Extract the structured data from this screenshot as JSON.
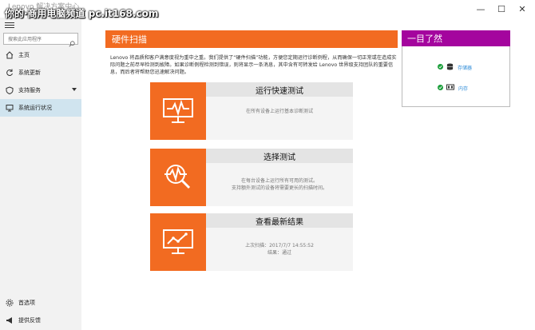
{
  "window": {
    "title": "Lenovo 解决方案中心",
    "watermark": "你的·商用电脑频道 pc.it168.com",
    "minimize": "—",
    "maximize": "☐",
    "close": "✕"
  },
  "sidebar": {
    "search_placeholder": "搜索此应用程序",
    "items": [
      {
        "label": "主页",
        "icon": "home-icon"
      },
      {
        "label": "系统更新",
        "icon": "refresh-icon"
      },
      {
        "label": "支持服务",
        "icon": "shield-icon"
      },
      {
        "label": "系统运行状况",
        "icon": "monitor-icon"
      }
    ],
    "bottom": [
      {
        "label": "首选项",
        "icon": "gear-icon"
      },
      {
        "label": "提供反馈",
        "icon": "megaphone-icon"
      }
    ]
  },
  "main": {
    "header": "硬件扫描",
    "description": "Lenovo 将品质和客户满意度视为重中之重。我们提供了“硬件扫描”功能，方便您定期运行诊断例程，从而确保一切正常或在造成实际问题之前尽早检测到故障。如果诊断例程检测到错误，则将显示一条消息，其中含有可转发给 Lenovo 世界级支持团队的重要信息，而后者将帮助您迅速解决问题。",
    "cards": [
      {
        "title": "运行快速测试",
        "lines": [
          "在所有设备上运行基本诊断测试"
        ]
      },
      {
        "title": "选择测试",
        "lines": [
          "在每台设备上运行所有可用的测试。",
          "支持额外测试的设备将需要更长的扫描时间。"
        ]
      },
      {
        "title": "查看最新结果",
        "lines": [
          "上次扫描：2017/7/7 14:55:52",
          "结果：通过"
        ]
      }
    ]
  },
  "rpanel": {
    "title": "一目了然",
    "items": [
      {
        "label": "存储器",
        "status": "ok"
      },
      {
        "label": "内存",
        "status": "ok"
      }
    ]
  },
  "colors": {
    "orange": "#f26b21",
    "purple": "#a4059e",
    "active": "#d0e4ef",
    "link": "#2e8cd8",
    "ok": "#1a9e3a"
  }
}
